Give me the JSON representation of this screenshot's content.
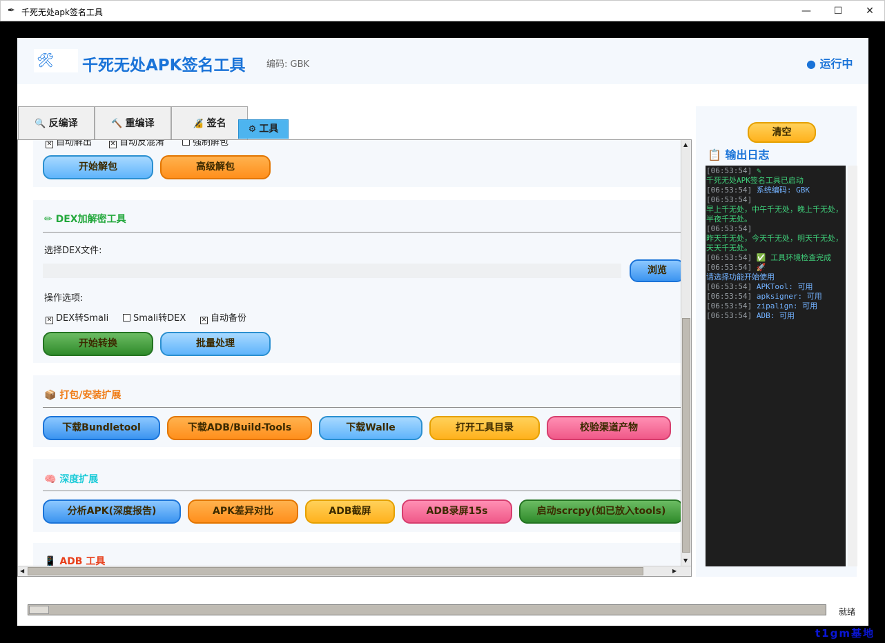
{
  "window": {
    "title": "千死无处apk签名工具",
    "controls": {
      "minimize": "—",
      "maximize": "☐",
      "close": "✕"
    }
  },
  "header": {
    "title": "千死无处APK签名工具",
    "encoding": "编码: GBK",
    "status": "● 运行中"
  },
  "tabs": [
    {
      "label": "反编译",
      "icon": "magnifier-icon",
      "glyph": "🔍"
    },
    {
      "label": "重编译",
      "icon": "hammer-icon",
      "glyph": "🔨"
    },
    {
      "label": "签名",
      "icon": "padlock-icon",
      "glyph": "🔏"
    },
    {
      "label": "工具",
      "icon": "gear-icon",
      "glyph": "⚙",
      "active": true
    }
  ],
  "unpack_section": {
    "options": [
      {
        "label": "自动解出",
        "checked": true
      },
      {
        "label": "自动反混淆",
        "checked": true
      },
      {
        "label": "强制解包",
        "checked": false
      }
    ],
    "buttons": [
      "开始解包",
      "高级解包"
    ]
  },
  "dex_section": {
    "title": "DEX加解密工具",
    "file_label": "选择DEX文件:",
    "file_value": "",
    "browse": "浏览",
    "options_label": "操作选项:",
    "options": [
      {
        "label": "DEX转Smali",
        "checked": true
      },
      {
        "label": "Smali转DEX",
        "checked": false
      },
      {
        "label": "自动备份",
        "checked": true
      }
    ],
    "buttons": [
      "开始转换",
      "批量处理"
    ]
  },
  "pack_section": {
    "title": "打包/安装扩展",
    "buttons": [
      "下载Bundletool",
      "下载ADB/Build-Tools",
      "下载Walle",
      "打开工具目录",
      "校验渠道产物"
    ]
  },
  "deep_section": {
    "title": "深度扩展",
    "buttons": [
      "分析APK(深度报告)",
      "APK差异对比",
      "ADB截屏",
      "ADB录屏15s",
      "启动scrcpy(如已放入tools)"
    ]
  },
  "adb_section": {
    "title": "ADB 工具"
  },
  "output": {
    "clear": "清空",
    "title": "输出日志",
    "lines": [
      {
        "ts": "[06:53:54]",
        "text": " ✎",
        "cls": "g"
      },
      {
        "ts": "",
        "text": "千死无处APK签名工具已启动",
        "cls": "g"
      },
      {
        "ts": "[06:53:54]",
        "text": " 系统编码: GBK",
        "cls": "b"
      },
      {
        "ts": "[06:53:54]",
        "text": "",
        "cls": "g"
      },
      {
        "ts": "",
        "text": "早上千无处，中午千无处，晚上千无处，半夜千无处。",
        "cls": "g"
      },
      {
        "ts": "[06:53:54]",
        "text": "",
        "cls": "g"
      },
      {
        "ts": "",
        "text": "昨天千无处，今天千无处，明天千无处，天天千无处。",
        "cls": "g"
      },
      {
        "ts": "[06:53:54]",
        "text": " ✅ 工具环境检查完成",
        "cls": "g"
      },
      {
        "ts": "[06:53:54]",
        "text": " 🚀",
        "cls": "b"
      },
      {
        "ts": "",
        "text": "请选择功能开始使用",
        "cls": "b"
      },
      {
        "ts": "[06:53:54]",
        "text": " APKTool: 可用",
        "cls": "b"
      },
      {
        "ts": "[06:53:54]",
        "text": " apksigner: 可用",
        "cls": "b"
      },
      {
        "ts": "[06:53:54]",
        "text": " zipalign: 可用",
        "cls": "b"
      },
      {
        "ts": "[06:53:54]",
        "text": " ADB: 可用",
        "cls": "b"
      }
    ]
  },
  "statusbar": {
    "progress": 0,
    "text": "就绪"
  },
  "watermark": "t1gm基地"
}
